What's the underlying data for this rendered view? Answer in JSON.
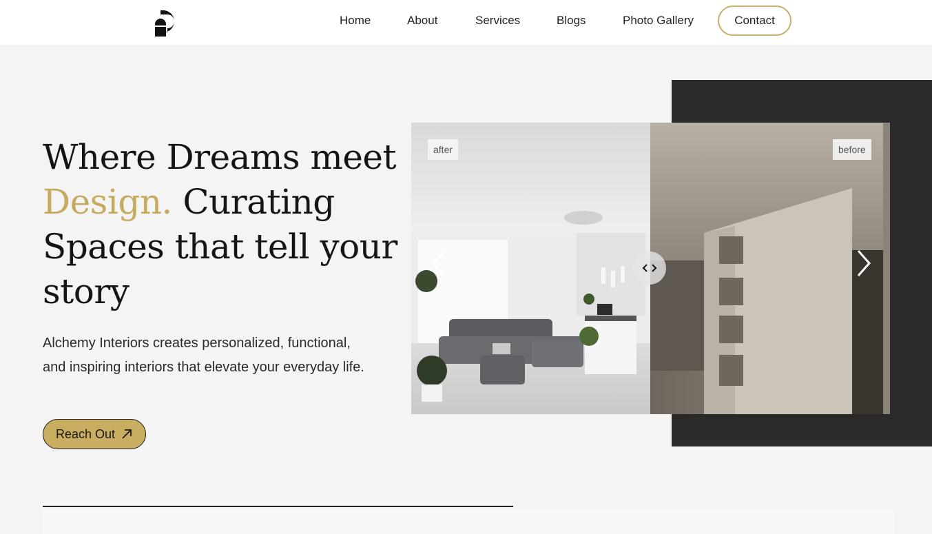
{
  "nav": {
    "items": [
      "Home",
      "About",
      "Services",
      "Blogs",
      "Photo Gallery"
    ],
    "contact": "Contact"
  },
  "hero": {
    "title_line1": "Where Dreams meet",
    "title_accent": "Design.",
    "title_rest": " Curating Spaces that tell your story",
    "description": "Alchemy Interiors creates personalized, functional, and inspiring interiors that elevate your everyday life.",
    "cta": "Reach Out"
  },
  "gallery": {
    "after_label": "after",
    "before_label": "before"
  },
  "colors": {
    "accent": "#c6ab5f",
    "button": "#c9ae62",
    "dark_block": "#2a2a2a",
    "background": "#f4f4f4"
  },
  "icons": {
    "logo": "brand-logo-icon",
    "cta_arrow": "arrow-up-right-icon",
    "prev": "chevron-left-icon",
    "next": "chevron-right-icon",
    "handle": "compare-handle-icon"
  }
}
